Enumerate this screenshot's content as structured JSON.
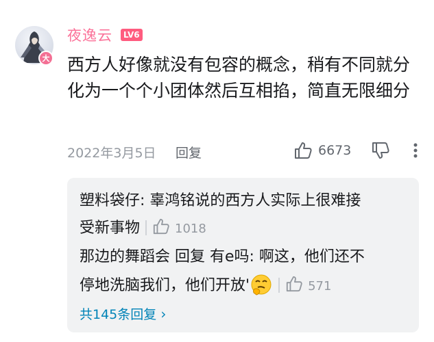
{
  "comment": {
    "username": "夜逸云",
    "level": "LV6",
    "avatar_badge": "大",
    "text": "西方人好像就没有包容的概念，稍有不同就分化为一个个小团体然后互相掐，简直无限细分",
    "date": "2022年3月5日",
    "reply_label": "回复",
    "like_count": "6673",
    "icons": {
      "like": "thumbs-up-icon",
      "dislike": "thumbs-down-icon",
      "more": "more-vertical-icon"
    }
  },
  "sub_replies": {
    "items": [
      {
        "user": "塑料袋仔",
        "text_line1": "塑料袋仔: 辜鸿铭说的西方人实际上很难接",
        "text_line2": "受新事物",
        "like_count": "1018"
      },
      {
        "user": "那边的舞蹈会",
        "reply_word": "回复",
        "reply_to": "有e吗",
        "text_line1": "那边的舞蹈会 回复 有e吗: 啊这，他们还不",
        "text_line2": "停地洗脑我们，他们开放'",
        "emoji": "thinking-emoji-icon",
        "like_count": "571"
      }
    ],
    "total_label": "共145条回复",
    "colors": {
      "link": "#0083b7",
      "box_bg": "#f1f2f3"
    }
  },
  "colors": {
    "username": "#fb7299",
    "level_bg": "#ff5c7f",
    "meta": "#9499a0"
  }
}
